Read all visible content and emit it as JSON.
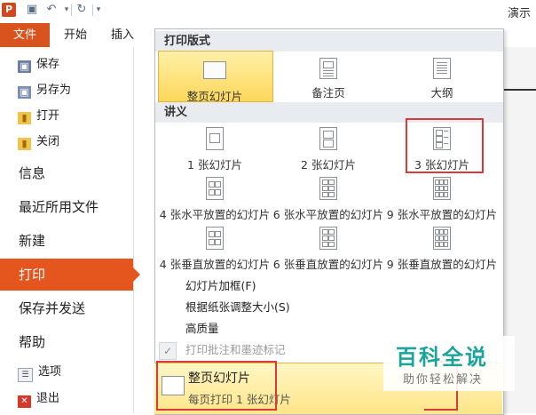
{
  "titlebar": {
    "app_icon": "P",
    "title": "演示",
    "quick_access": [
      "save-icon",
      "undo-icon",
      "redo-icon",
      "customize-icon"
    ]
  },
  "tabs": {
    "file": "文件",
    "home": "开始",
    "insert": "插入",
    "ext": "│└"
  },
  "nav": {
    "save": "保存",
    "save_as": "另存为",
    "open": "打开",
    "close": "关闭",
    "info": "信息",
    "recent": "最近所用文件",
    "new": "新建",
    "print": "打印",
    "save_send": "保存并发送",
    "help": "帮助",
    "options": "选项",
    "exit": "退出"
  },
  "dropdown": {
    "layout_header": "打印版式",
    "layout_options": [
      "整页幻灯片",
      "备注页",
      "大纲"
    ],
    "handouts_header": "讲义",
    "handout_options": [
      "1 张幻灯片",
      "2 张幻灯片",
      "3 张幻灯片",
      "4 张水平放置的幻灯片",
      "6 张水平放置的幻灯片",
      "9 张水平放置的幻灯片",
      "4 张垂直放置的幻灯片",
      "6 张垂直放置的幻灯片",
      "9 张垂直放置的幻灯片"
    ],
    "menu": {
      "frame": "幻灯片加框(F)",
      "scale": "根据纸张调整大小(S)",
      "quality": "高质量",
      "comments": "打印批注和墨迹标记"
    }
  },
  "selection": {
    "title": "整页幻灯片",
    "subtitle": "每页打印 1 张幻灯片"
  },
  "watermark": {
    "title": "百科全说",
    "subtitle": "助你轻松解决"
  },
  "colors": {
    "accent": "#e5561f",
    "highlight": "#fcd75b",
    "annotation": "#d93a3a",
    "watermark": "#1aa59a"
  }
}
